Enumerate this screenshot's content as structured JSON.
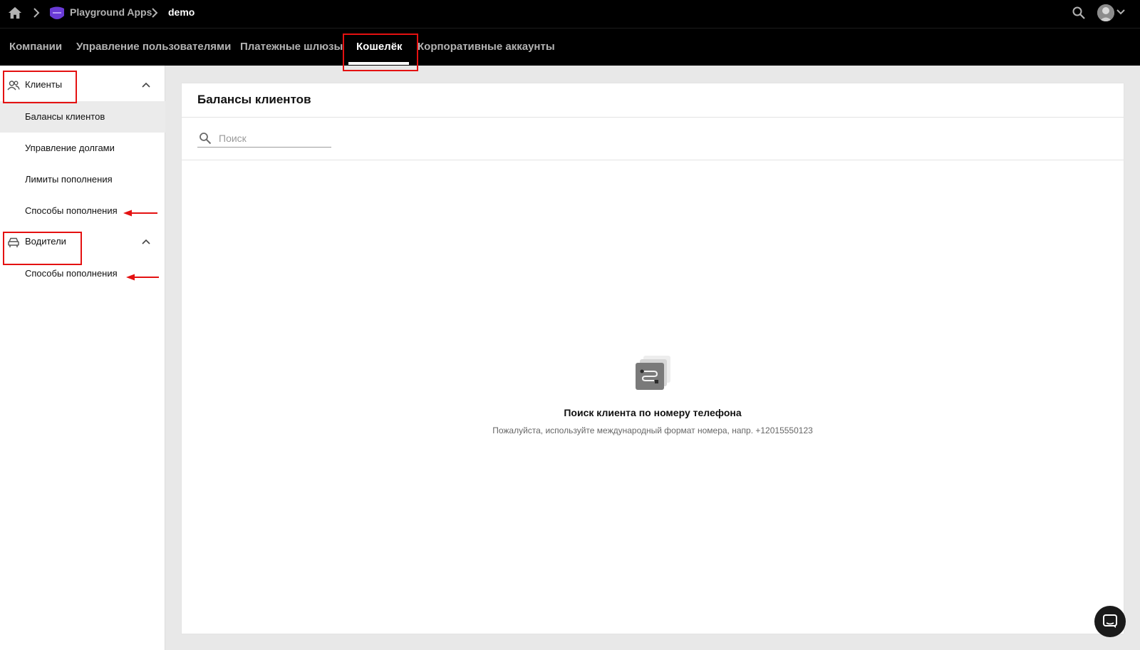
{
  "topbar": {
    "app_name": "Playground Apps",
    "current": "demo",
    "icons": [
      "home-icon",
      "chevron-right-icon",
      "app-logo",
      "search-icon",
      "avatar",
      "chevron-down-icon"
    ]
  },
  "nav": {
    "tabs": [
      {
        "label": "Компании",
        "active": false
      },
      {
        "label": "Управление пользователями",
        "active": false
      },
      {
        "label": "Платежные шлюзы",
        "active": false
      },
      {
        "label": "Кошелёк",
        "active": true
      },
      {
        "label": "Корпоративные аккаунты",
        "active": false
      }
    ]
  },
  "sidebar": {
    "groups": [
      {
        "label": "Клиенты",
        "icon": "users-icon",
        "expanded": true,
        "items": [
          {
            "label": "Балансы клиентов",
            "selected": true
          },
          {
            "label": "Управление долгами",
            "selected": false
          },
          {
            "label": "Лимиты пополнения",
            "selected": false
          },
          {
            "label": "Способы пополнения",
            "selected": false
          }
        ]
      },
      {
        "label": "Водители",
        "icon": "car-icon",
        "expanded": true,
        "items": [
          {
            "label": "Способы пополнения",
            "selected": false
          }
        ]
      }
    ]
  },
  "main": {
    "title": "Балансы клиентов",
    "search": {
      "placeholder": "Поиск",
      "value": ""
    },
    "empty_state": {
      "icon": "route-icon",
      "title": "Поиск клиента по номеру телефона",
      "subtitle": "Пожалуйста, используйте международный формат номера, напр. +12015550123"
    }
  },
  "colors": {
    "topbar_bg": "#000000",
    "annotation": "#e41111",
    "page_bg": "#e8e8e8",
    "card_bg": "#ffffff"
  }
}
